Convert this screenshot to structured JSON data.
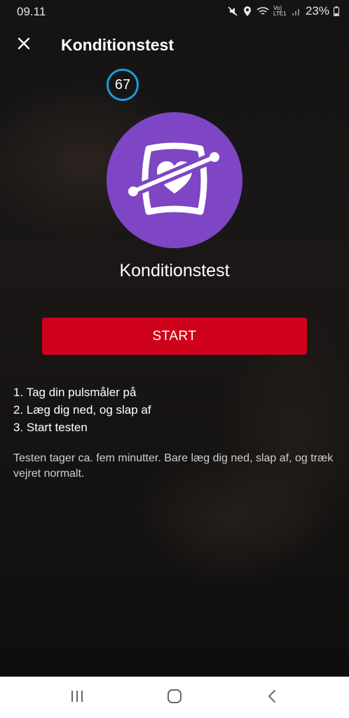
{
  "status_bar": {
    "time": "09.11",
    "network_label": "Vo) LTE1",
    "battery": "23%",
    "icons": [
      "mute-icon",
      "location-icon",
      "wifi-icon",
      "signal-icon",
      "battery-icon"
    ]
  },
  "header": {
    "title": "Konditionstest",
    "close_icon": "close-icon"
  },
  "score": {
    "value": "67"
  },
  "hero": {
    "icon": "heart-rate-strap-icon",
    "color": "#7e45c4"
  },
  "test_name": "Konditionstest",
  "start_button": {
    "label": "START",
    "color": "#d0021b"
  },
  "instructions": {
    "steps": [
      "1. Tag din pulsmåler på",
      "2. Læg dig ned, og slap af",
      "3. Start testen"
    ],
    "description": "Testen tager ca. fem minutter. Bare læg dig ned, slap af, og træk vejret normalt."
  },
  "nav_bar": {
    "buttons": [
      "recent-apps-icon",
      "home-icon",
      "back-icon"
    ]
  },
  "colors": {
    "accent_blue": "#1e9bdc",
    "accent_red": "#d0021b",
    "accent_purple": "#7e45c4"
  }
}
